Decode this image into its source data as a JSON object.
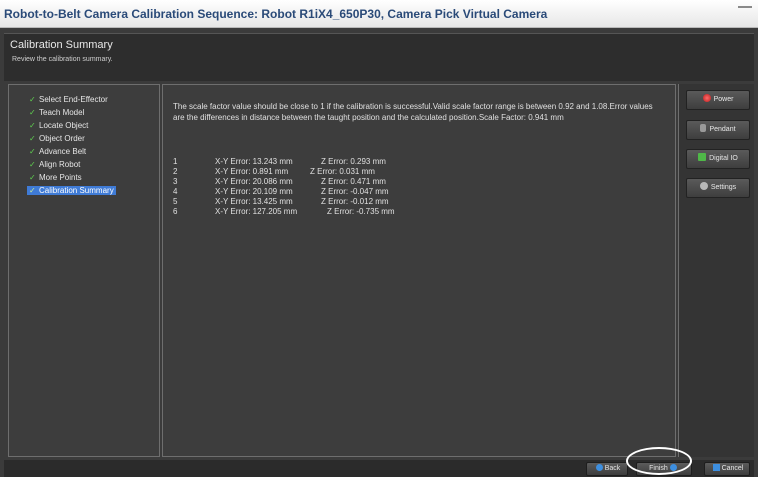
{
  "window": {
    "title": "Robot-to-Belt Camera Calibration Sequence: Robot R1iX4_650P30, Camera Pick Virtual Camera"
  },
  "header": {
    "title": "Calibration Summary",
    "subtitle": "Review the calibration summary."
  },
  "steps": [
    {
      "label": "Select End-Effector"
    },
    {
      "label": "Teach Model"
    },
    {
      "label": "Locate Object"
    },
    {
      "label": "Object Order"
    },
    {
      "label": "Advance Belt"
    },
    {
      "label": "Align Robot"
    },
    {
      "label": "More Points"
    },
    {
      "label": "Calibration Summary",
      "active": true
    }
  ],
  "summary": {
    "description": "The scale factor value should be close to 1 if the calibration is successful.Valid scale factor range is between 0.92 and 1.08.Error values are the differences in distance between the taught position and the calculated position.Scale Factor: 0.941 mm",
    "rows": [
      {
        "n": "1",
        "xy": "X-Y Error: 13.243 mm",
        "z": "Z Error: 0.293 mm"
      },
      {
        "n": "2",
        "xy": "X-Y Error: 0.891 mm",
        "z": "Z Error: 0.031 mm"
      },
      {
        "n": "3",
        "xy": "X-Y Error: 20.086 mm",
        "z": "Z Error: 0.471 mm"
      },
      {
        "n": "4",
        "xy": "X-Y Error: 20.109 mm",
        "z": "Z Error: -0.047 mm"
      },
      {
        "n": "5",
        "xy": "X-Y Error: 13.425 mm",
        "z": "Z Error: -0.012 mm"
      },
      {
        "n": "6",
        "xy": "X-Y Error: 127.205 mm",
        "z": "Z Error: -0.735 mm"
      }
    ]
  },
  "side_buttons": {
    "power": "Power",
    "pendant": "Pendant",
    "digital_io": "Digital IO",
    "settings": "Settings"
  },
  "footer": {
    "back": "Back",
    "finish": "Finish",
    "cancel": "Cancel"
  },
  "icons": {
    "step_check": "check-icon",
    "power": "power-icon",
    "pendant": "pendant-icon",
    "digital_io": "digital-io-icon",
    "settings": "settings-icon",
    "back": "back-arrow-icon",
    "finish": "finish-arrow-icon",
    "cancel": "cancel-x-icon"
  },
  "colors": {
    "active_step": "#3f7bd6",
    "check": "#5fcf4f",
    "title_text": "#2a4a78"
  }
}
